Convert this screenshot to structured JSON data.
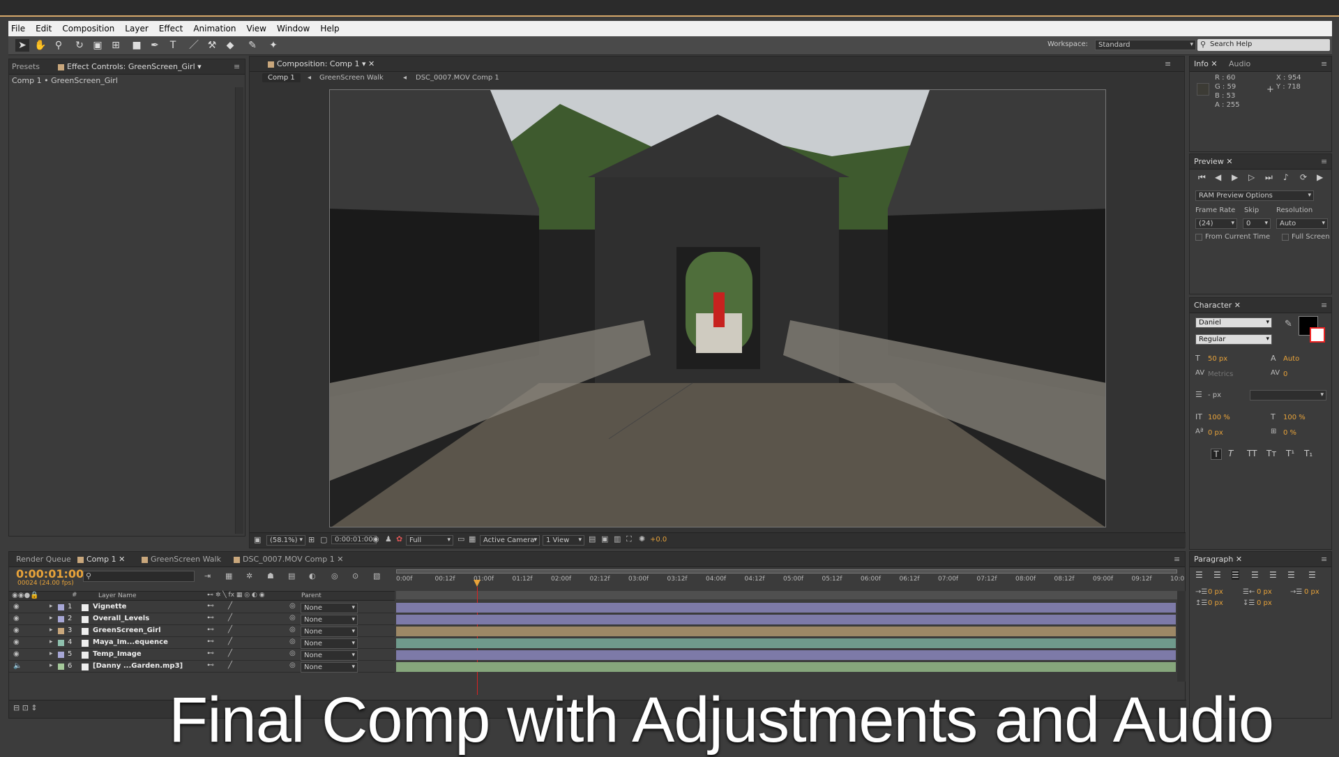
{
  "menu": [
    "File",
    "Edit",
    "Composition",
    "Layer",
    "Effect",
    "Animation",
    "View",
    "Window",
    "Help"
  ],
  "workspace": {
    "label": "Workspace:",
    "value": "Standard",
    "search_placeholder": "Search Help"
  },
  "left_panel": {
    "tab_presets": "Presets",
    "tab_effect": "Effect Controls: GreenScreen_Girl",
    "breadcrumb": "Comp 1 • GreenScreen_Girl"
  },
  "comp_panel": {
    "tab": "Composition: Comp 1",
    "crumbs": [
      "Comp 1",
      "GreenScreen Walk",
      "DSC_0007.MOV Comp 1"
    ],
    "zoom": "(58.1%)",
    "timecode": "0:00:01:00",
    "resolution": "Full",
    "camera": "Active Camera",
    "views": "1 View",
    "exposure": "+0.0"
  },
  "info": {
    "tab_info": "Info",
    "tab_audio": "Audio",
    "r": "R : 60",
    "g": "G : 59",
    "b": "B : 53",
    "a": "A : 255",
    "x": "X : 954",
    "y": "Y : 718"
  },
  "preview": {
    "tab": "Preview",
    "options": "RAM Preview Options",
    "frame_rate_label": "Frame Rate",
    "skip_label": "Skip",
    "resolution_label": "Resolution",
    "frame_rate": "(24)",
    "skip": "0",
    "resolution": "Auto",
    "from_current": "From Current Time",
    "full_screen": "Full Screen"
  },
  "character": {
    "tab": "Character",
    "font": "Daniel",
    "style": "Regular",
    "size": "50 px",
    "leading": "Auto",
    "kerning": "Metrics",
    "tracking": "0",
    "stroke": "- px",
    "vscale": "100 %",
    "hscale": "100 %",
    "baseline": "0 px",
    "tsume": "0 %",
    "styles": [
      "T",
      "T",
      "TT",
      "Tт",
      "T¹",
      "T₁"
    ]
  },
  "paragraph": {
    "tab": "Paragraph",
    "indent_left": "0 px",
    "indent_right": "0 px",
    "indent_first": "0 px",
    "space_before": "0 px",
    "space_after": "0 px"
  },
  "timeline": {
    "tabs": [
      "Render Queue",
      "Comp 1",
      "GreenScreen Walk",
      "DSC_0007.MOV Comp 1"
    ],
    "timecode": "0:00:01:00",
    "frames": "00024 (24.00 fps)",
    "col_layer": "Layer Name",
    "col_num": "#",
    "col_parent": "Parent",
    "ruler": [
      "0:00f",
      "00:12f",
      "01:00f",
      "01:12f",
      "02:00f",
      "02:12f",
      "03:00f",
      "03:12f",
      "04:00f",
      "04:12f",
      "05:00f",
      "05:12f",
      "06:00f",
      "06:12f",
      "07:00f",
      "07:12f",
      "08:00f",
      "08:12f",
      "09:00f",
      "09:12f",
      "10:0"
    ],
    "layers": [
      {
        "num": "1",
        "name": "Vignette",
        "parent": "None",
        "color": "#a7a7d6"
      },
      {
        "num": "2",
        "name": "Overall_Levels",
        "parent": "None",
        "color": "#a7a7d6"
      },
      {
        "num": "3",
        "name": "GreenScreen_Girl",
        "parent": "None",
        "color": "#c9a77c"
      },
      {
        "num": "4",
        "name": "Maya_Im...equence",
        "parent": "None",
        "color": "#8fc1ae"
      },
      {
        "num": "5",
        "name": "Temp_Image",
        "parent": "None",
        "color": "#a7a7d6"
      },
      {
        "num": "6",
        "name": "[Danny ...Garden.mp3]",
        "parent": "None",
        "color": "#a5c99a"
      }
    ]
  },
  "colors": {
    "layer_purple": "#7d7aa8",
    "layer_tan": "#9d8866",
    "layer_teal": "#6f9a8c",
    "layer_green": "#86a67c",
    "accent": "#e8a33a"
  },
  "caption": "Final Comp with Adjustments and Audio"
}
